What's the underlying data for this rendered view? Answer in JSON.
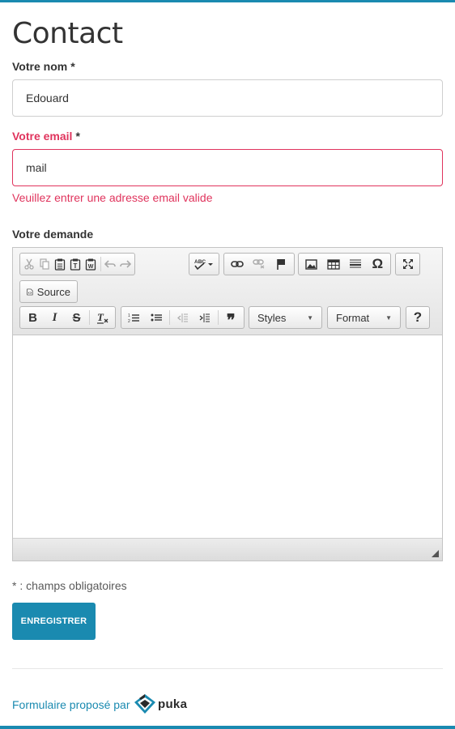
{
  "page": {
    "title": "Contact"
  },
  "form": {
    "name": {
      "label": "Votre nom",
      "required": "*",
      "value": "Edouard"
    },
    "email": {
      "label": "Votre email",
      "required": "*",
      "value": "mail",
      "error": "Veuillez entrer une adresse email valide"
    },
    "request": {
      "label": "Votre demande"
    }
  },
  "editor": {
    "toolbar": {
      "source_label": "Source",
      "styles_label": "Styles",
      "format_label": "Format",
      "help_label": "?"
    },
    "icons": {
      "cut": "cut-icon",
      "copy": "copy-icon",
      "paste": "paste-icon",
      "paste_text": "paste-text-icon",
      "paste_word": "paste-word-icon",
      "undo": "undo-icon",
      "redo": "redo-icon",
      "spellcheck": "spellcheck-icon",
      "link": "link-icon",
      "unlink": "unlink-icon",
      "anchor": "anchor-flag-icon",
      "image": "image-icon",
      "table": "table-icon",
      "hr": "horizontal-rule-icon",
      "special_char": "omega-icon",
      "maximize": "maximize-icon",
      "bold": "bold-icon",
      "italic": "italic-icon",
      "strike": "strikethrough-icon",
      "remove_format": "remove-format-icon",
      "numbered_list": "numbered-list-icon",
      "bulleted_list": "bulleted-list-icon",
      "outdent": "outdent-icon",
      "indent": "indent-icon",
      "blockquote": "blockquote-icon"
    },
    "glyphs": {
      "bold": "B",
      "italic": "I",
      "strike": "S",
      "remove_format": "Tx",
      "blockquote": "❞",
      "special_char": "Ω",
      "spell": "ABC"
    }
  },
  "footer": {
    "required_note": "* : champs obligatoires",
    "submit_label": "ENREGISTRER",
    "powered_by": "Formulaire proposé par",
    "brand": "puka"
  },
  "colors": {
    "accent": "#1a8ab0",
    "error": "#e0345d"
  }
}
